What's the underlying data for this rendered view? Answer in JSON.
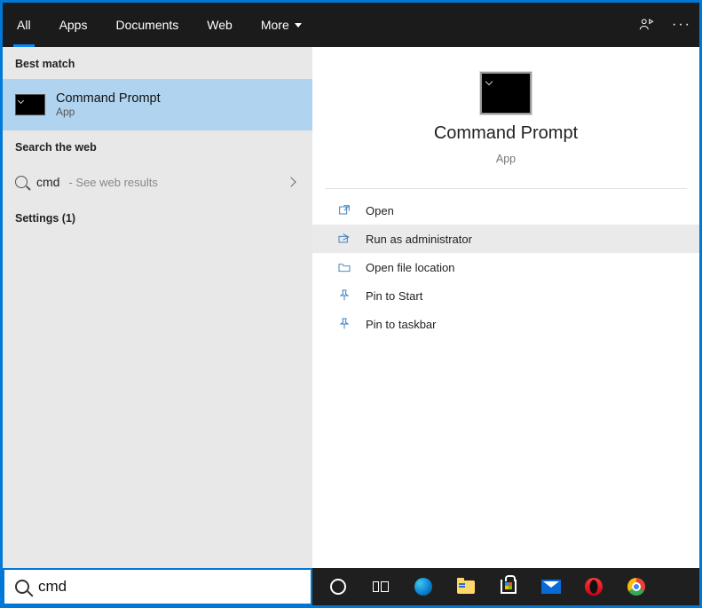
{
  "tabs": {
    "all": "All",
    "apps": "Apps",
    "documents": "Documents",
    "web": "Web",
    "more": "More"
  },
  "left": {
    "bestMatchHead": "Best match",
    "bestMatch": {
      "title": "Command Prompt",
      "subtitle": "App"
    },
    "searchWebHead": "Search the web",
    "webRow": {
      "query": "cmd",
      "hint": " - See web results"
    },
    "settingsHead": "Settings (1)"
  },
  "preview": {
    "title": "Command Prompt",
    "subtitle": "App"
  },
  "actions": {
    "open": "Open",
    "runAdmin": "Run as administrator",
    "openLoc": "Open file location",
    "pinStart": "Pin to Start",
    "pinTaskbar": "Pin to taskbar"
  },
  "search": {
    "value": "cmd"
  }
}
